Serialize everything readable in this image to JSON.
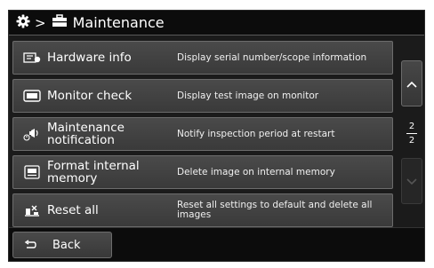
{
  "header": {
    "separator": ">",
    "title": "Maintenance"
  },
  "menu": [
    {
      "label": "Hardware info",
      "description": "Display serial number/scope information",
      "icon": "hardware-info-icon"
    },
    {
      "label": "Monitor check",
      "description": "Display test image on monitor",
      "icon": "monitor-icon"
    },
    {
      "label": "Maintenance notification",
      "description": "Notify inspection period at restart",
      "icon": "notification-icon"
    },
    {
      "label": "Format internal memory",
      "description": "Delete image on internal memory",
      "icon": "memory-icon"
    },
    {
      "label": "Reset all",
      "description": "Reset all settings to default and delete all images",
      "icon": "reset-icon"
    }
  ],
  "pagination": {
    "current": "2",
    "total": "2"
  },
  "footer": {
    "back_label": "Back"
  },
  "colors": {
    "background": "#1b1b1b",
    "button": "#444444",
    "text": "#ffffff"
  }
}
